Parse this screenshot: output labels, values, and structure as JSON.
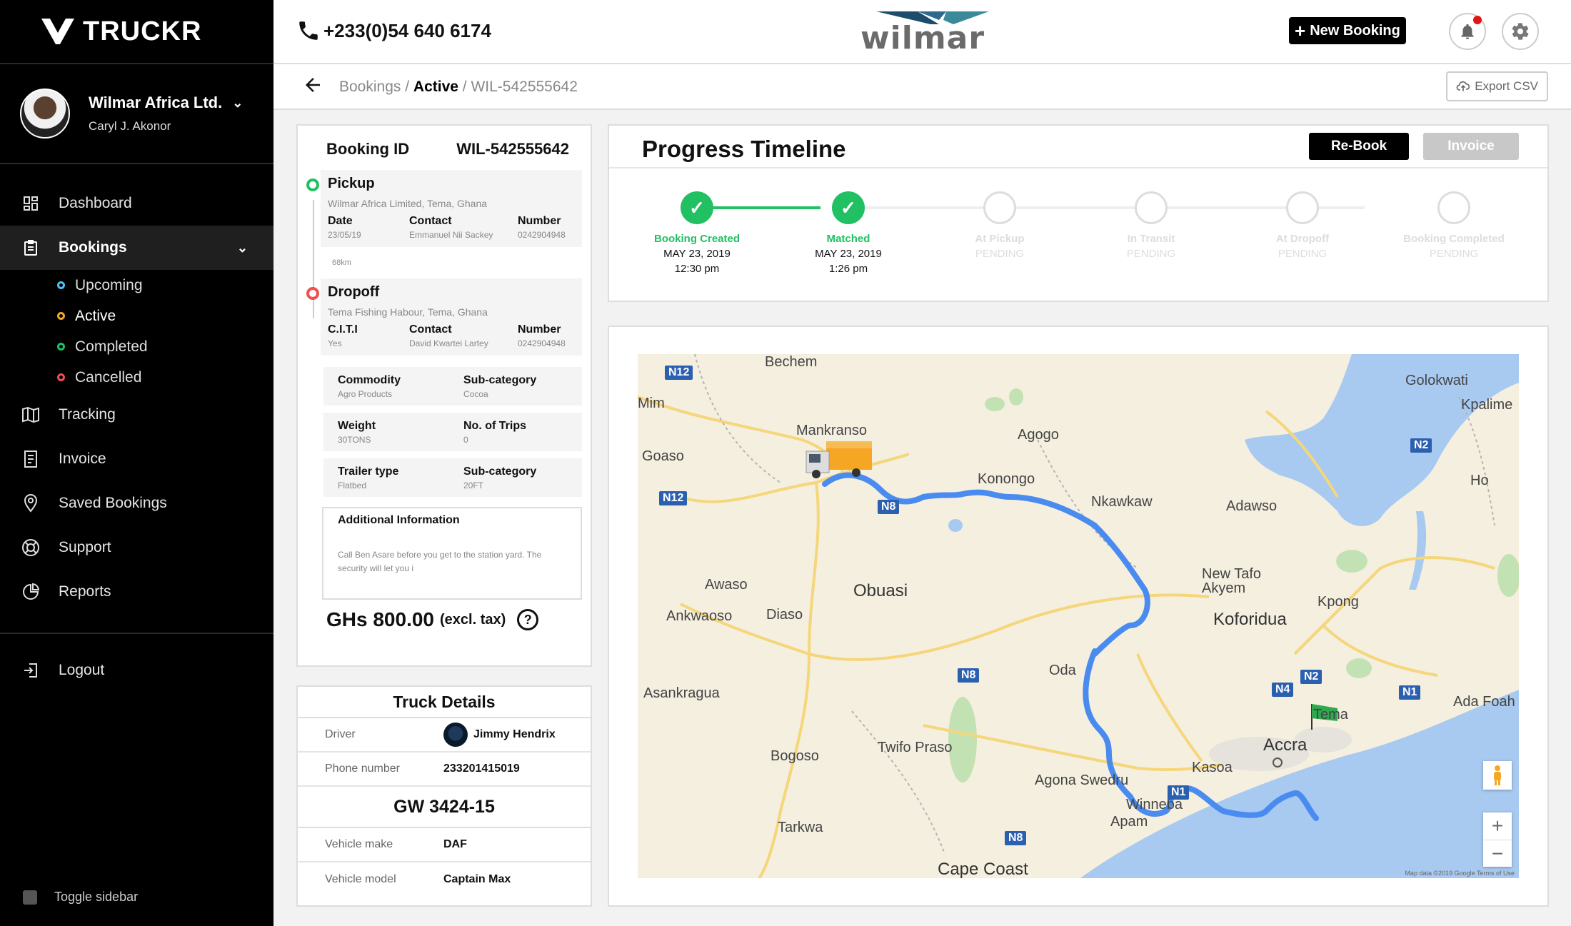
{
  "sidebar": {
    "logo": "TRUCKR",
    "company": "Wilmar Africa Ltd.",
    "user": "Caryl J. Akonor",
    "nav": [
      {
        "label": "Dashboard"
      },
      {
        "label": "Bookings"
      },
      {
        "label": "Tracking"
      },
      {
        "label": "Invoice"
      },
      {
        "label": "Saved Bookings"
      },
      {
        "label": "Support"
      },
      {
        "label": "Reports"
      }
    ],
    "sub_items": [
      {
        "label": "Upcoming",
        "color": "#4fc3f7"
      },
      {
        "label": "Active",
        "color": "#f5a623"
      },
      {
        "label": "Completed",
        "color": "#21c063"
      },
      {
        "label": "Cancelled",
        "color": "#f0504f"
      }
    ],
    "logout": "Logout",
    "toggle": "Toggle sidebar"
  },
  "topbar": {
    "phone": "+233(0)54 640 6174",
    "brand": "wilmar",
    "new_booking": "New Booking"
  },
  "breadcrumb": {
    "root": "Bookings",
    "sep1": " / ",
    "current": "Active",
    "sep2": " / ",
    "leaf": "WIL-542555642",
    "export": "Export CSV"
  },
  "booking": {
    "id_label": "Booking ID",
    "id": "WIL-542555642",
    "pickup": {
      "title": "Pickup",
      "address": "Wilmar Africa Limited, Tema, Ghana",
      "f1_label": "Date",
      "f1_value": "23/05/19",
      "f2_label": "Contact",
      "f2_value": "Emmanuel Nii Sackey",
      "f3_label": "Number",
      "f3_value": "0242904948"
    },
    "distance": "68km",
    "dropoff": {
      "title": "Dropoff",
      "address": "Tema Fishing Habour, Tema, Ghana",
      "f1_label": "C.I.T.I",
      "f1_value": "Yes",
      "f2_label": "Contact",
      "f2_value": "David Kwartei Lartey",
      "f3_label": "Number",
      "f3_value": "0242904948"
    },
    "commodity_label": "Commodity",
    "commodity": "Agro Products",
    "subcat_label": "Sub-category",
    "subcat": "Cocoa",
    "weight_label": "Weight",
    "weight": "30TONS",
    "trips_label": "No. of Trips",
    "trips": "0",
    "trailer_label": "Trailer type",
    "trailer": "Flatbed",
    "trailer_sub_label": "Sub-category",
    "trailer_sub": "20FT",
    "additional_label": "Additional Information",
    "additional_text": "Call Ben Asare before you get to the station yard. The security will let you i",
    "price": "GHs 800.00",
    "price_note": "(excl. tax)"
  },
  "truck": {
    "title": "Truck Details",
    "driver_label": "Driver",
    "driver": "Jimmy Hendrix",
    "phone_label": "Phone number",
    "phone": "233201415019",
    "plate": "GW 3424-15",
    "make_label": "Vehicle make",
    "make": "DAF",
    "model_label": "Vehicle model",
    "model": "Captain Max"
  },
  "timeline": {
    "title": "Progress Timeline",
    "rebook": "Re-Book",
    "invoice": "Invoice",
    "accent": "#21c063",
    "steps": [
      {
        "label": "Booking Created",
        "date": "MAY 23, 2019",
        "time": "12:30 pm",
        "done": true
      },
      {
        "label": "Matched",
        "date": "MAY 23, 2019",
        "time": "1:26 pm",
        "done": true
      },
      {
        "label": "At Pickup",
        "status": "PENDING",
        "done": false
      },
      {
        "label": "In Transit",
        "status": "PENDING",
        "done": false
      },
      {
        "label": "At Dropoff",
        "status": "PENDING",
        "done": false
      },
      {
        "label": "Booking Completed",
        "status": "PENDING",
        "done": false
      }
    ]
  },
  "map": {
    "places": [
      "Bechem",
      "Mim",
      "Goaso",
      "Mankranso",
      "Agogo",
      "Konongo",
      "Nkawkaw",
      "Adawso",
      "Golokwati",
      "Kpalime",
      "Ho",
      "New Tafo Akyem",
      "Koforidua",
      "Kpong",
      "Awaso",
      "Ankwaoso",
      "Diaso",
      "Obuasi",
      "Oda",
      "Asankragua",
      "Bogoso",
      "Twifo Praso",
      "Agona Swedru",
      "Kasoa",
      "Accra",
      "Tema",
      "Ada Foah",
      "Winneba",
      "Apam",
      "Tarkwa",
      "Cape Coast"
    ],
    "roads": [
      "N12",
      "N12",
      "N8",
      "N8",
      "N8",
      "N2",
      "N2",
      "N4",
      "N1",
      "N1"
    ],
    "attribution": "Map data ©2019 Google   Terms of Use"
  }
}
